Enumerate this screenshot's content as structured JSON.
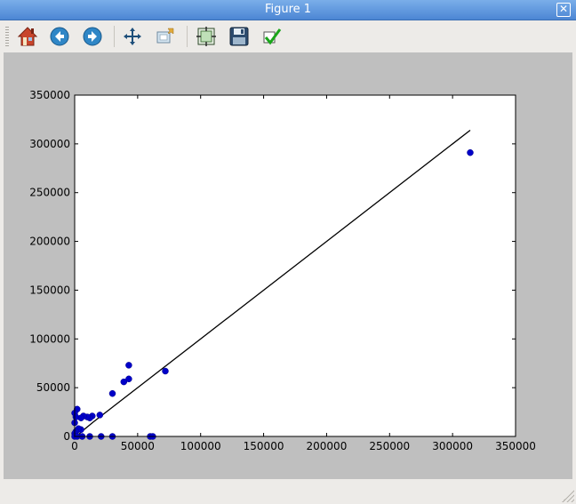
{
  "window": {
    "title": "Figure 1",
    "close_glyph": "✕"
  },
  "toolbar": {
    "buttons": [
      {
        "name": "home-icon",
        "icon": "home"
      },
      {
        "name": "back-icon",
        "icon": "arrow-left"
      },
      {
        "name": "forward-icon",
        "icon": "arrow-right"
      },
      {
        "name": "pan-icon",
        "icon": "move"
      },
      {
        "name": "zoom-icon",
        "icon": "zoom-rect"
      },
      {
        "name": "subplots-icon",
        "icon": "configure-subplots"
      },
      {
        "name": "save-icon",
        "icon": "floppy-disk"
      },
      {
        "name": "edit-icon",
        "icon": "checkmark"
      }
    ]
  },
  "chart_data": {
    "type": "scatter",
    "title": "",
    "xlabel": "",
    "ylabel": "",
    "xlim": [
      0,
      350000
    ],
    "ylim": [
      0,
      350000
    ],
    "xticks": [
      0,
      50000,
      100000,
      150000,
      200000,
      250000,
      300000,
      350000
    ],
    "yticks": [
      0,
      50000,
      100000,
      150000,
      200000,
      250000,
      300000,
      350000
    ],
    "xtick_labels": [
      "0",
      "50000",
      "100000",
      "150000",
      "200000",
      "250000",
      "300000",
      "350000"
    ],
    "ytick_labels": [
      "0",
      "50000",
      "100000",
      "150000",
      "200000",
      "250000",
      "300000",
      "350000"
    ],
    "grid": false,
    "marker_color": "#0000c8",
    "line_color": "#000000",
    "series": [
      {
        "kind": "scatter",
        "points": [
          [
            314000,
            291000
          ],
          [
            72000,
            67000
          ],
          [
            43000,
            73000
          ],
          [
            43000,
            59000
          ],
          [
            39000,
            56000
          ],
          [
            30000,
            44000
          ],
          [
            20000,
            22000
          ],
          [
            14000,
            21000
          ],
          [
            12000,
            19000
          ],
          [
            10000,
            20000
          ],
          [
            7000,
            21000
          ],
          [
            5000,
            19000
          ],
          [
            2000,
            28000
          ],
          [
            0,
            24000
          ],
          [
            1000,
            20000
          ],
          [
            0,
            14000
          ],
          [
            5000,
            7000
          ],
          [
            3000,
            8000
          ],
          [
            1000,
            5000
          ],
          [
            0,
            3000
          ],
          [
            0,
            0
          ],
          [
            2000,
            0
          ],
          [
            6000,
            0
          ],
          [
            12000,
            0
          ],
          [
            21000,
            0
          ],
          [
            30000,
            0
          ],
          [
            60000,
            0
          ],
          [
            62000,
            0
          ]
        ]
      },
      {
        "kind": "line",
        "points": [
          [
            0,
            0
          ],
          [
            2000,
            0
          ],
          [
            5000,
            4500
          ],
          [
            15000,
            15000
          ],
          [
            314000,
            314000
          ]
        ]
      }
    ]
  }
}
